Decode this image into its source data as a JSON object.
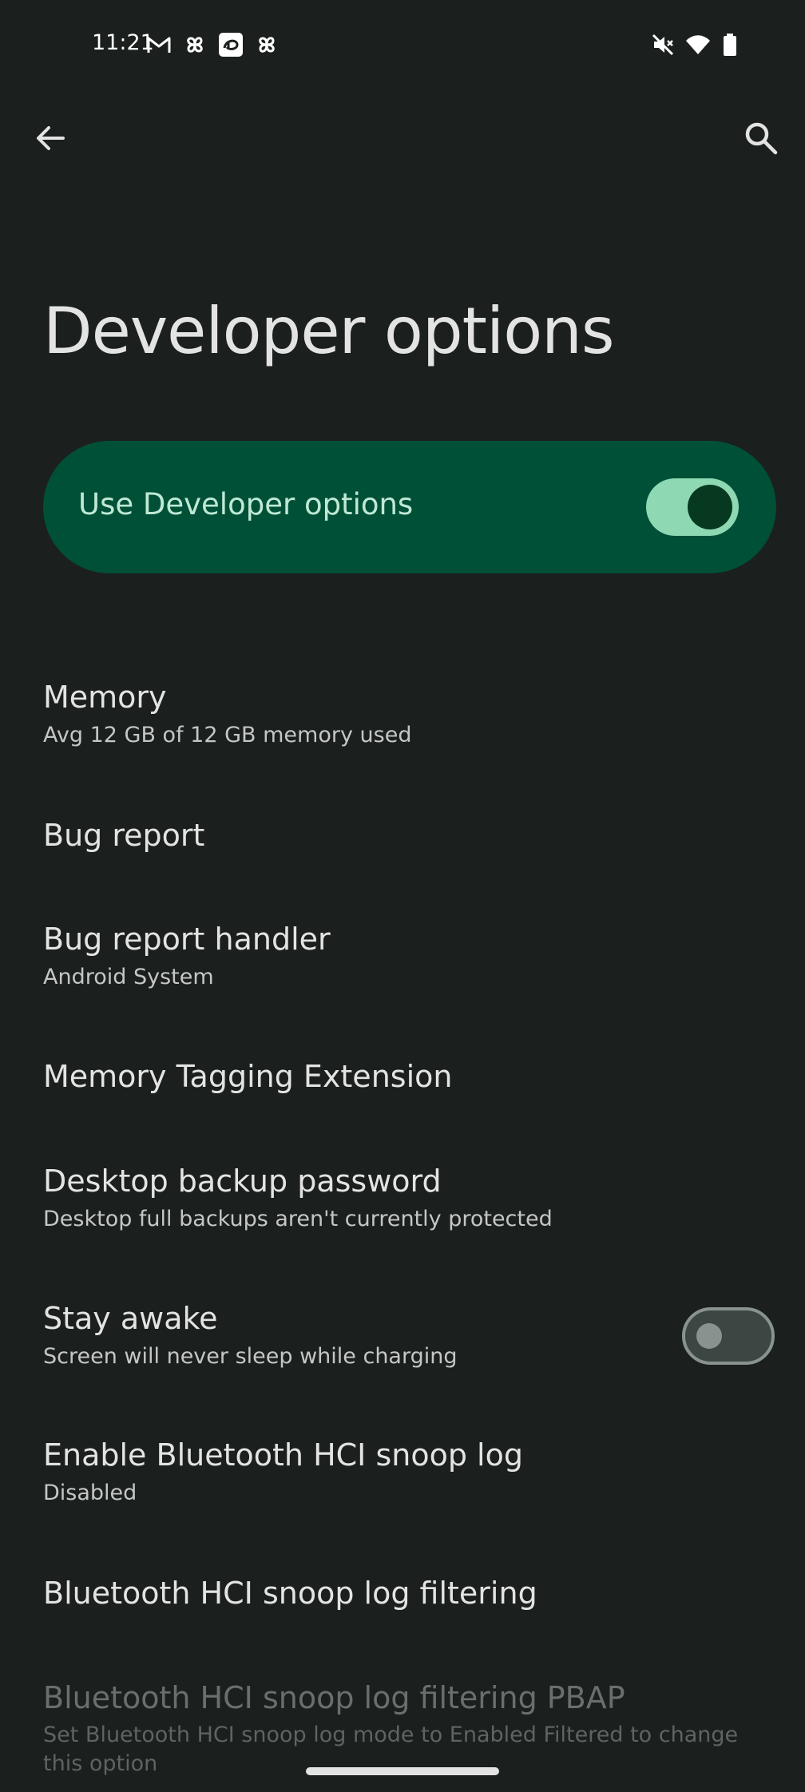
{
  "status_bar": {
    "time": "11:21",
    "left_icons": [
      "gmail-icon",
      "pinwheel-icon",
      "disney-plus-icon",
      "pinwheel-icon"
    ],
    "right_icons": [
      "mute-icon",
      "wifi-icon",
      "battery-icon"
    ]
  },
  "app_bar": {
    "back_icon": "arrow-back-icon",
    "search_icon": "search-icon"
  },
  "page": {
    "title": "Developer options"
  },
  "main_switch": {
    "label": "Use Developer options",
    "checked": true
  },
  "preferences": [
    {
      "title": "Memory",
      "summary": "Avg 12 GB of 12 GB memory used"
    },
    {
      "title": "Bug report",
      "summary": ""
    },
    {
      "title": "Bug report handler",
      "summary": "Android System"
    },
    {
      "title": "Memory Tagging Extension",
      "summary": ""
    },
    {
      "title": "Desktop backup password",
      "summary": "Desktop full backups aren't currently protected"
    },
    {
      "title": "Stay awake",
      "summary": "Screen will never sleep while charging",
      "checked": false
    },
    {
      "title": "Enable Bluetooth HCI snoop log",
      "summary": "Disabled"
    },
    {
      "title": "Bluetooth HCI snoop log filtering",
      "summary": ""
    },
    {
      "title": "Bluetooth HCI snoop log filtering PBAP",
      "summary": "Set Bluetooth HCI snoop log mode to Enabled Filtered to change this option",
      "enabled": false
    }
  ],
  "colors": {
    "background": "#1b1f1e",
    "main_switch_bg": "#005038",
    "toggle_on_track": "#8fd8b4",
    "toggle_on_knob": "#06391f",
    "toggle_off_outline": "#889390"
  }
}
